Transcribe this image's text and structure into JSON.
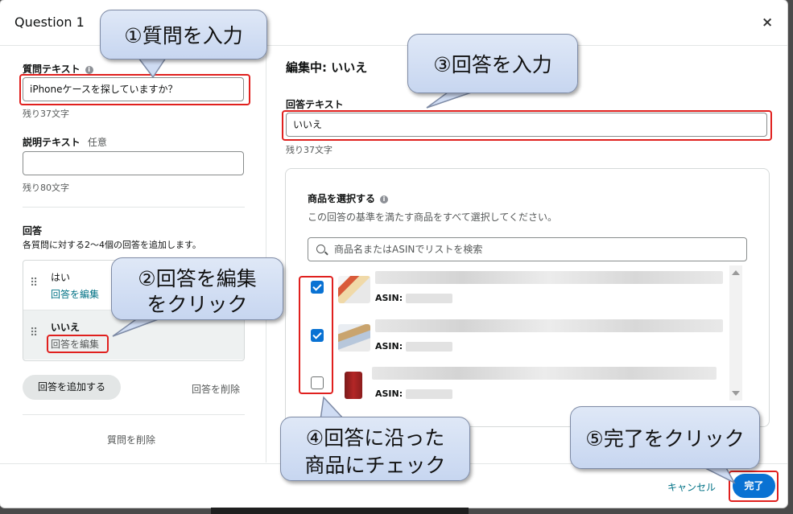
{
  "modal": {
    "title": "Question 1",
    "close": "×"
  },
  "left": {
    "question_label": "質問テキスト",
    "question_value": "iPhoneケースを探していますか？",
    "question_remaining": "残り37文字",
    "desc_label": "説明テキスト",
    "desc_optional": "任意",
    "desc_value": "",
    "desc_remaining": "残り80文字",
    "answers_heading": "回答",
    "answers_sub": "各質問に対する2〜4個の回答を追加します。",
    "answers": [
      {
        "name": "はい",
        "edit": "回答を編集"
      },
      {
        "name": "いいえ",
        "edit": "回答を編集"
      }
    ],
    "add_answer": "回答を追加する",
    "delete_answer": "回答を削除",
    "delete_question": "質問を削除"
  },
  "right": {
    "editing_label": "編集中: いいえ",
    "answer_label": "回答テキスト",
    "answer_value": "いいえ",
    "answer_remaining": "残り37文字",
    "products_label": "商品を選択する",
    "products_sub": "この回答の基準を満たす商品をすべて選択してください。",
    "search_placeholder": "商品名またはASINでリストを検索",
    "products": [
      {
        "checked": true,
        "asin_label": "ASIN:"
      },
      {
        "checked": true,
        "asin_label": "ASIN:"
      },
      {
        "checked": false,
        "asin_label": "ASIN:"
      }
    ]
  },
  "footer": {
    "cancel": "キャンセル",
    "done": "完了"
  },
  "callouts": {
    "c1": "①質問を入力",
    "c2_line1": "②回答を編集",
    "c2_line2": "をクリック",
    "c3": "③回答を入力",
    "c4_line1": "④回答に沿った",
    "c4_line2": "商品にチェック",
    "c5": "⑤完了をクリック"
  },
  "colors": {
    "accent": "#0972d3",
    "link": "#007185",
    "highlight": "#e0201e"
  }
}
